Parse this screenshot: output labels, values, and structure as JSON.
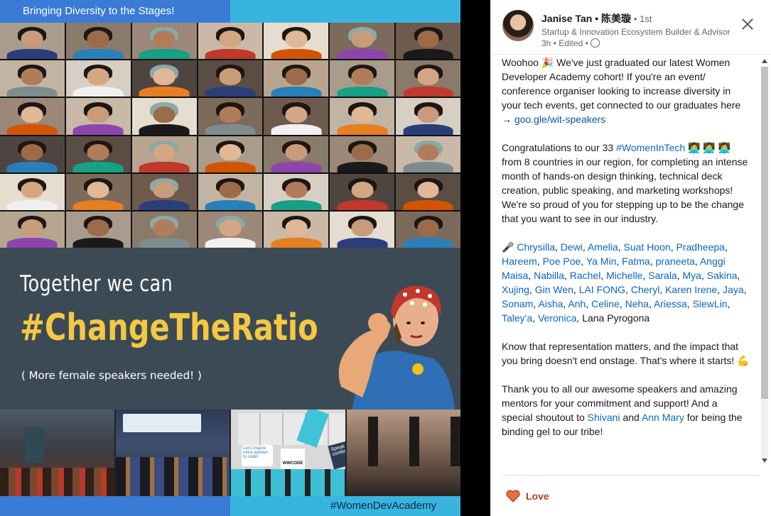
{
  "image": {
    "top_banner": "Bringing Diversity to the Stages!",
    "banner_title": "Together we can",
    "banner_hashtag": "#ChangeTheRatio",
    "banner_subtitle": "( More female speakers needed! )",
    "bottom_banner": "#WomenDevAcademy",
    "photo_sign_1": "Let's inspire more women to code!",
    "photo_sign_2": "Speak at a conference",
    "photo_sign_3": "WWCODE"
  },
  "post": {
    "author": "Janise Tan • 陈美璇",
    "degree": "• 1st",
    "headline": "Startup & Innovation Ecosystem Builder & Advisor",
    "meta": "3h • Edited •",
    "para1_a": "Woohoo 🎉 We've just graduated our latest Women Developer Academy cohort! If you're an event/ conference organiser looking to increase diversity in your tech events, get connected to our graduates here → ",
    "para1_link": "goo.gle/wit-speakers",
    "para2_a": "Congratulations to our 33 ",
    "para2_tag": "#WomenInTech",
    "para2_b": " 👩‍💻 👩‍💻 👩‍💻 from 8 countries in our region, for completing an intense month of hands-on design thinking, technical deck creation, public speaking, and marketing workshops! We're so proud of you for stepping up to be the change that you want to see in our industry.",
    "mic": "🎤 ",
    "names": [
      "Chrysilla",
      "Dewi",
      "Amelia",
      "Suat Hoon",
      "Pradheepa",
      "Hareem",
      "Poe Poe",
      "Ya Min",
      "Fatma",
      "praneeta",
      "Anggi Maisa",
      "Nabilla",
      "Rachel",
      "Michelle",
      "Sarala",
      "Mya",
      "Sakina",
      "Xujing",
      "Gin Wen",
      "LAI FONG",
      "Cheryl",
      "Karen Irene",
      "Jaya",
      "Sonam",
      "Aisha",
      "Anh",
      "Celine",
      "Neha",
      "Ariessa",
      "SiewLin",
      "Taley'a",
      "Veronica"
    ],
    "last_name": "Lana Pyrogona",
    "para4": "Know that representation matters, and the impact that you bring doesn't end onstage. That's where it starts! 💪",
    "para5_a": "Thank you to all our awesome speakers and amazing mentors for your commitment and support! And a special shoutout to ",
    "shout_1": "Shivani",
    "para5_and": " and ",
    "shout_2": "Ann Mary",
    "para5_b": " for being the binding gel to our tribe!",
    "reaction_label": "Love"
  },
  "colors": {
    "link": "#0a66c2",
    "hashtag_yellow": "#f5c842",
    "banner_bg": "#3c4a55",
    "love": "#b24020"
  }
}
